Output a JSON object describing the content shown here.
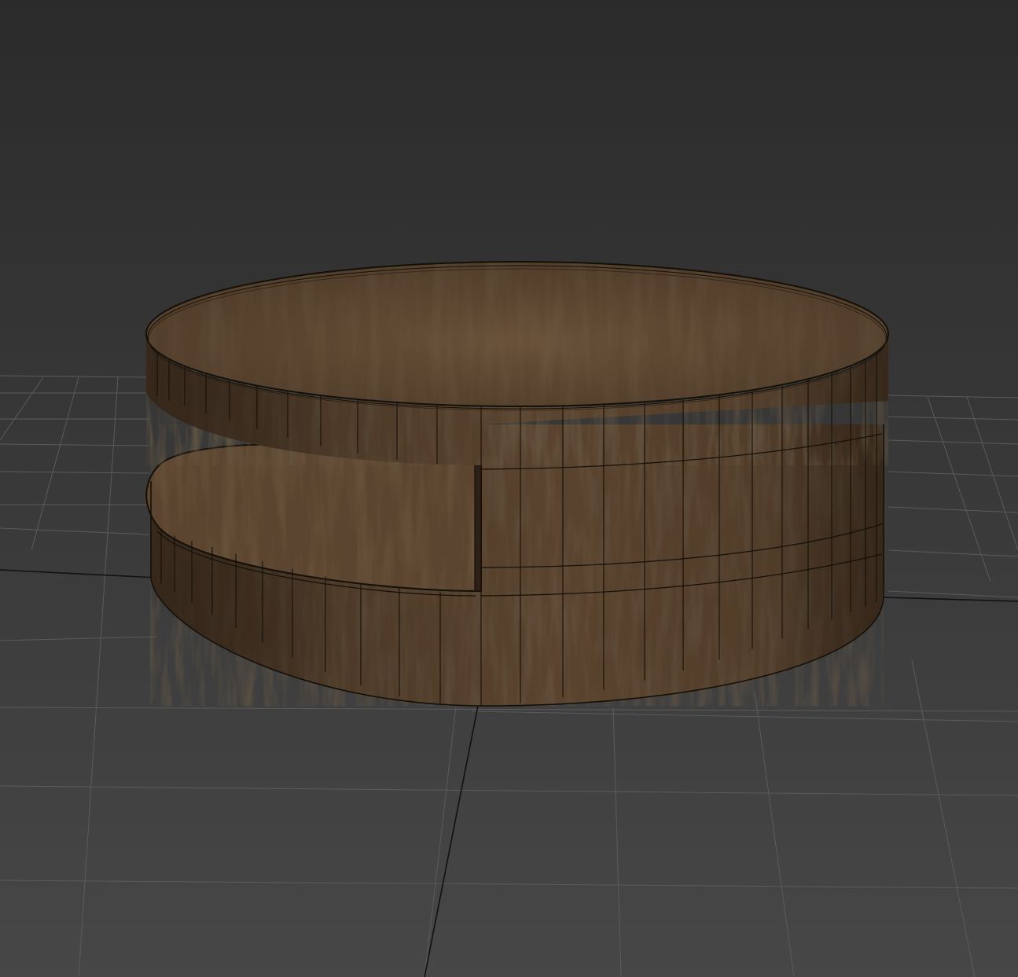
{
  "viewport": {
    "name": "3d-perspective-viewport",
    "background_top": "#2b2b2b",
    "background_bottom": "#474747",
    "grid_color": "#5b5b5b",
    "grid_major_color": "#111111"
  },
  "model": {
    "name": "round-coffee-table",
    "material": "wood",
    "wood_light": "#6b5139",
    "wood_mid": "#58412d",
    "wood_dark": "#3a2a1c",
    "wire_color": "#141008",
    "wireframe": true
  }
}
